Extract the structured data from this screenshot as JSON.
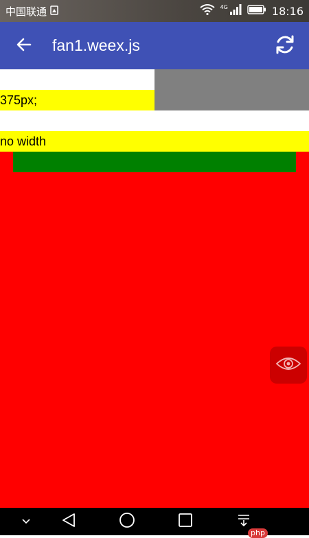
{
  "status_bar": {
    "carrier": "中国联通",
    "network": "4G",
    "time": "18:16"
  },
  "app_bar": {
    "title": "fan1.weex.js",
    "back_icon": "arrow-back-icon",
    "refresh_icon": "refresh-icon"
  },
  "content": {
    "row1_text": "375px;",
    "row2_text": "no width",
    "colors": {
      "gray": "#808080",
      "yellow": "#ffff00",
      "red": "#ff0000",
      "green": "#008000"
    },
    "floating_icon": "eye-icon"
  },
  "nav_bar": {
    "badge": "php",
    "icons": [
      "chevron-down-icon",
      "back-triangle-icon",
      "home-circle-icon",
      "recents-square-icon",
      "notification-pull-icon"
    ]
  }
}
